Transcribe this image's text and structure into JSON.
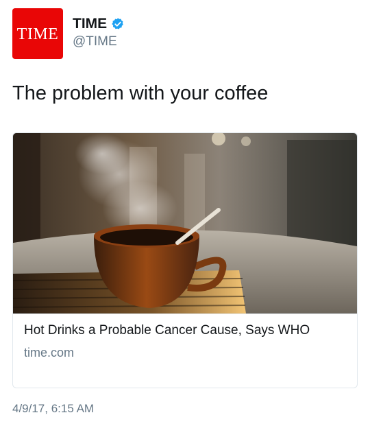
{
  "account": {
    "avatar_text": "TIME",
    "display_name": "TIME",
    "handle": "@TIME",
    "verified": true,
    "avatar_color": "#e90606",
    "verified_color": "#1da1f2"
  },
  "tweet": {
    "text": "The problem with your coffee",
    "timestamp": "4/9/17, 6:15 AM"
  },
  "card": {
    "title": "Hot Drinks a Probable Cancer Cause, Says WHO",
    "domain": "time.com",
    "image_subject": "steaming-coffee-cup"
  }
}
